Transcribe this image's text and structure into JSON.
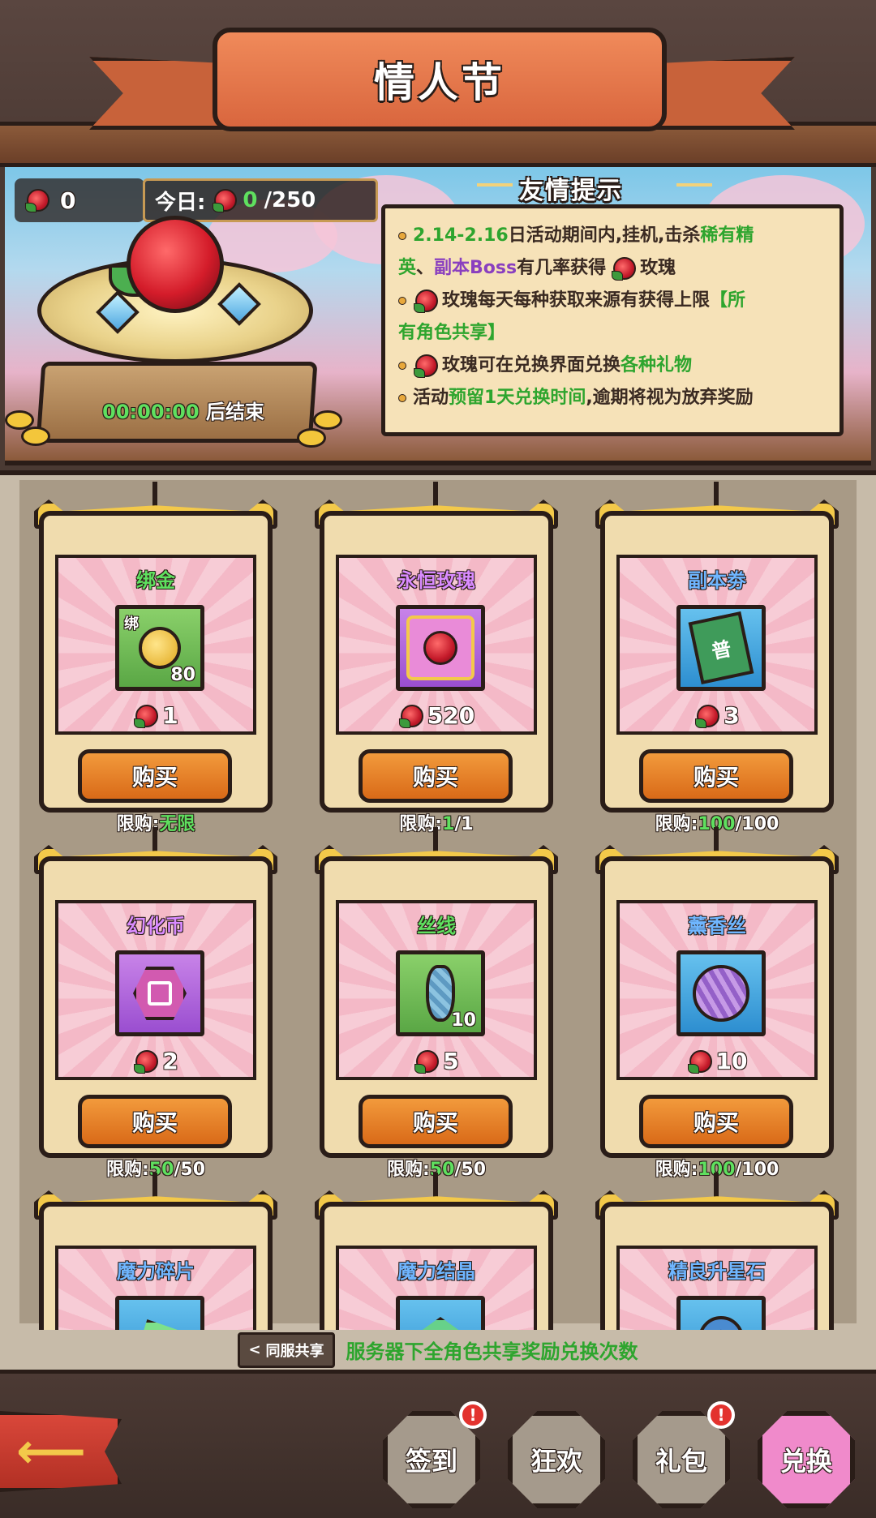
{
  "header": {
    "title": "情人节"
  },
  "balance": {
    "rose_count": "0"
  },
  "today": {
    "label": "今日:",
    "current": "0",
    "limit": "/250"
  },
  "countdown": {
    "time": "00:00:00",
    "suffix": "后结束"
  },
  "tips": {
    "title": "友情提示",
    "line1_a": "2.14-2.16",
    "line1_b": "日活动期间内,挂机,击杀",
    "line1_c": "稀有精",
    "line2_a": "英",
    "line2_b": "、",
    "line2_c": "副本Boss",
    "line2_d": "有几率获得",
    "line2_e": "玫瑰",
    "line3_a": "玫瑰每天每种获取来源有获得上限",
    "line3_b": "【所",
    "line4_a": "有角色共享】",
    "line5_a": "玫瑰可在兑换界面兑换",
    "line5_b": "各种礼物",
    "line6_a": "活动",
    "line6_b": "预留1天兑换时间",
    "line6_c": ",逾期将视为放弃奖励"
  },
  "shop": {
    "buy_label": "购买",
    "limit_label": "限购:",
    "items": [
      {
        "name": "绑金",
        "name_color": "green",
        "icon": "bound-gold-icon",
        "icon_tag": "绑",
        "icon_count": "80",
        "price": "1",
        "limit_used": "无限",
        "limit_total": ""
      },
      {
        "name": "永恒玫瑰",
        "name_color": "purple",
        "icon": "eternal-rose-icon",
        "icon_tag": "",
        "icon_count": "",
        "price": "520",
        "limit_used": "1",
        "limit_total": "/1"
      },
      {
        "name": "副本劵",
        "name_color": "blue",
        "icon": "dungeon-ticket-icon",
        "icon_tag": "普",
        "icon_count": "",
        "price": "3",
        "limit_used": "100",
        "limit_total": "/100"
      },
      {
        "name": "幻化币",
        "name_color": "purple",
        "icon": "transform-coin-icon",
        "icon_tag": "",
        "icon_count": "",
        "price": "2",
        "limit_used": "50",
        "limit_total": "/50"
      },
      {
        "name": "丝线",
        "name_color": "green",
        "icon": "silk-thread-icon",
        "icon_tag": "",
        "icon_count": "10",
        "price": "5",
        "limit_used": "50",
        "limit_total": "/50"
      },
      {
        "name": "薰香丝",
        "name_color": "blue",
        "icon": "incense-silk-icon",
        "icon_tag": "",
        "icon_count": "",
        "price": "10",
        "limit_used": "100",
        "limit_total": "/100"
      },
      {
        "name": "魔力碎片",
        "name_color": "blue",
        "icon": "magic-shard-icon"
      },
      {
        "name": "魔力结晶",
        "name_color": "blue",
        "icon": "magic-crystal-icon"
      },
      {
        "name": "精良升星石",
        "name_color": "blue",
        "icon": "star-stone-icon"
      }
    ]
  },
  "share": {
    "tag": "同服共享",
    "text": "服务器下全角色共享奖励兑换次数"
  },
  "nav": {
    "checkin": "签到",
    "carnival": "狂欢",
    "gift": "礼包",
    "exchange": "兑换",
    "badge": "!"
  },
  "colors": {
    "green": "#2ea52e",
    "purple": "#8a3fbf",
    "blue": "#2f77d6",
    "button": "#e07a25"
  }
}
